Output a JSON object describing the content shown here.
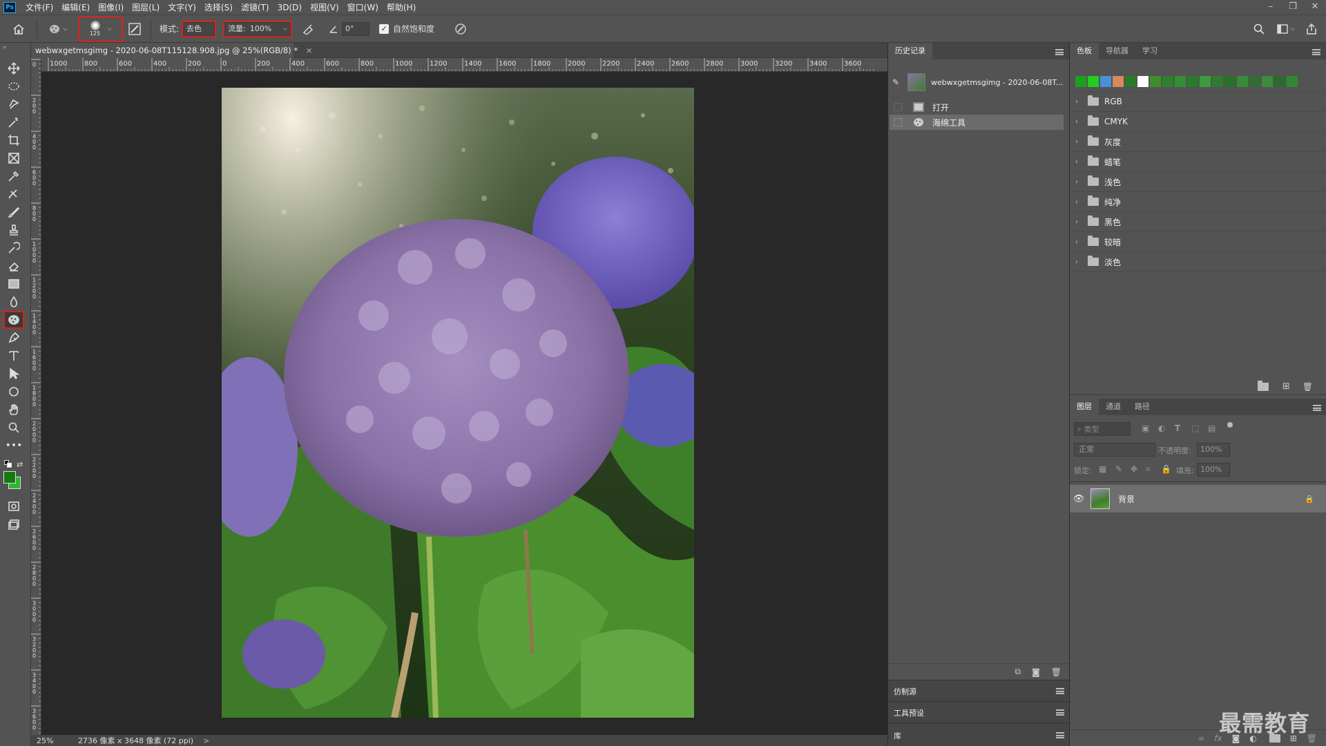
{
  "app": {
    "logo": "Ps",
    "menu": [
      "文件(F)",
      "编辑(E)",
      "图像(I)",
      "图层(L)",
      "文字(Y)",
      "选择(S)",
      "滤镜(T)",
      "3D(D)",
      "视图(V)",
      "窗口(W)",
      "帮助(H)"
    ]
  },
  "options": {
    "brush_size": "125",
    "mode_label": "模式:",
    "mode_value": "去色",
    "flow_label": "流量:",
    "flow_value": "100%",
    "angle_value": "0°",
    "vibrance_label": "自然饱和度",
    "vibrance_checked": true
  },
  "document": {
    "tab_title": "webwxgetmsgimg - 2020-06-08T115128.908.jpg @ 25%(RGB/8) *",
    "close_glyph": "×",
    "ruler_top_labels": [
      "1000",
      "800",
      "600",
      "400",
      "200",
      "0",
      "200",
      "400",
      "600",
      "800",
      "1000",
      "1200",
      "1400",
      "1600",
      "1800",
      "2000",
      "2200",
      "2400",
      "2600",
      "2800",
      "3000",
      "3200",
      "3400",
      "3600"
    ],
    "ruler_left_labels": [
      "0",
      "2 0 0",
      "4 0 0",
      "6 0 0",
      "8 0 0",
      "1 0 0 0",
      "1 2 0 0",
      "1 4 0 0",
      "1 6 0 0",
      "1 8 0 0",
      "2 0 0 0",
      "2 2 0 0",
      "2 4 0 0",
      "2 6 0 0",
      "2 8 0 0",
      "3 0 0 0",
      "3 2 0 0",
      "3 4 0 0",
      "3 6 0 0"
    ]
  },
  "status": {
    "zoom": "25%",
    "info": "2736 像素 x 3648 像素 (72 ppi)",
    "arrow": ">"
  },
  "history_panel": {
    "tab": "历史记录",
    "snapshot_label": "webwxgetmsgimg - 2020-06-08T...",
    "items": [
      {
        "label": "打开",
        "icon": "document-icon"
      },
      {
        "label": "海绵工具",
        "icon": "sponge-icon"
      }
    ]
  },
  "collapsed_panels": [
    "仿制源",
    "工具预设",
    "库"
  ],
  "swatches_panel": {
    "tabs": [
      "色板",
      "导航器",
      "学习"
    ],
    "recent_colors": [
      "#1aa31a",
      "#22cc22",
      "#4a90d9",
      "#d98a5a",
      "#2b7a2b",
      "#ffffff",
      "#3d8f2e",
      "#2f7f2f",
      "#348f34",
      "#2a7a2a",
      "#3f9a3f",
      "#2d7d2d",
      "#2c6e2c",
      "#3a8a3a",
      "#2f6f2f",
      "#3c8c3c",
      "#2b6b2b",
      "#338833"
    ],
    "groups": [
      "RGB",
      "CMYK",
      "灰度",
      "蜡笔",
      "浅色",
      "纯净",
      "黑色",
      "较暗",
      "淡色"
    ]
  },
  "layers_panel": {
    "tabs": [
      "图层",
      "通道",
      "路径"
    ],
    "filter_placeholder": "类型",
    "blend_mode": "正常",
    "opacity_label": "不透明度:",
    "opacity_value": "100%",
    "lock_label": "锁定:",
    "fill_label": "填充:",
    "fill_value": "100%",
    "layers": [
      {
        "name": "背景",
        "visible": true,
        "locked": true
      }
    ]
  },
  "watermark": "最需教育"
}
